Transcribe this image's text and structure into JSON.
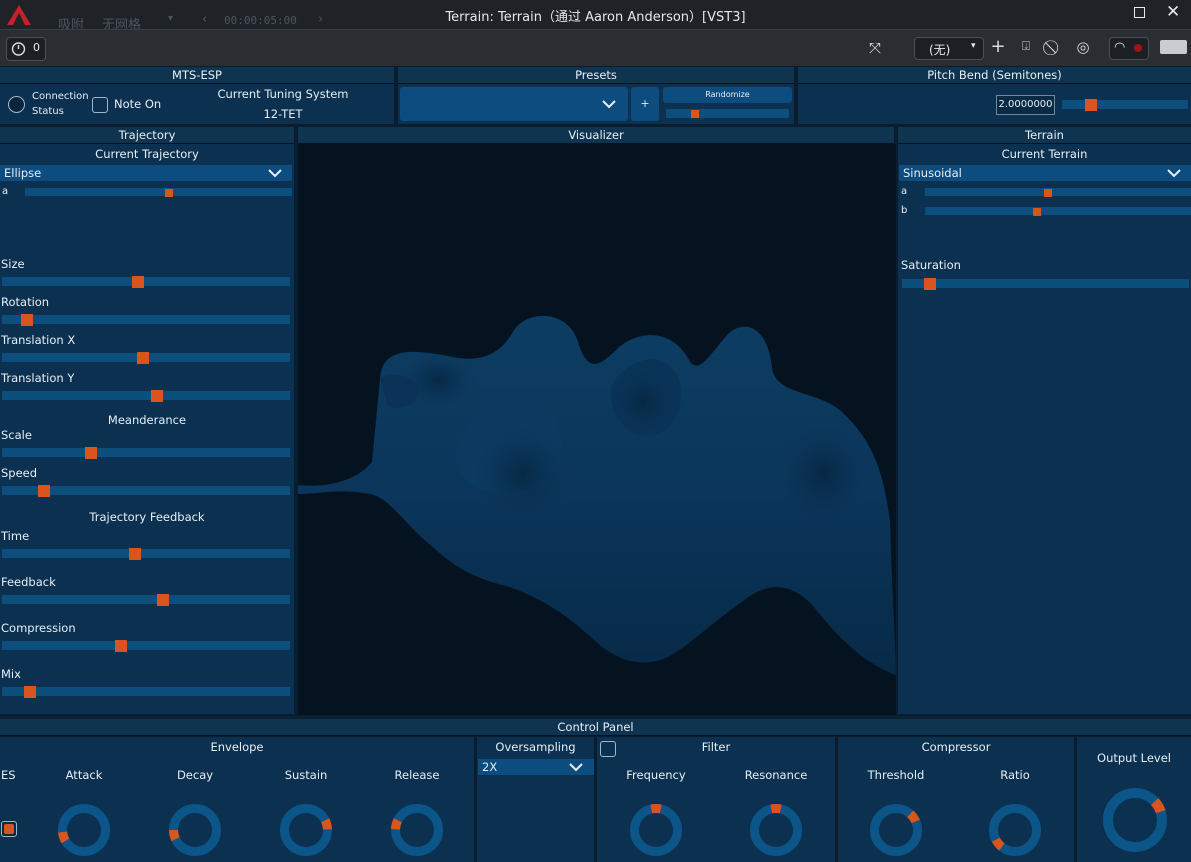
{
  "host": {
    "title": "Terrain: Terrain（通过 Aaron Anderson）[VST3]",
    "snap_label": "吸附",
    "grid_label": "无网格",
    "time": "00:00:05:00",
    "timer_value": "0",
    "preset_select": "(无)"
  },
  "mts": {
    "header": "MTS-ESP",
    "connection_label_line1": "Connection",
    "connection_label_line2": "Status",
    "note_on_label": "Note On",
    "tuning_label": "Current Tuning System",
    "tuning_value": "12-TET"
  },
  "presets": {
    "header": "Presets",
    "plus_label": "+",
    "randomize_label": "Randomize",
    "randomize_level": 0.22
  },
  "pitch_bend": {
    "header": "Pitch Bend (Semitones)",
    "value": "2.0000000",
    "level": 0.2
  },
  "trajectory": {
    "header": "Trajectory",
    "current_label": "Current Trajectory",
    "current_value": "Ellipse",
    "param_a_label": "a",
    "param_a_level": 0.54,
    "sliders": [
      {
        "label": "Size",
        "level": 0.47
      },
      {
        "label": "Rotation",
        "level": 0.07
      },
      {
        "label": "Translation X",
        "level": 0.49
      },
      {
        "label": "Translation Y",
        "level": 0.54
      }
    ],
    "meanderance_label": "Meanderance",
    "meanderance": [
      {
        "label": "Scale",
        "level": 0.3
      },
      {
        "label": "Speed",
        "level": 0.13
      }
    ],
    "feedback_label": "Trajectory Feedback",
    "feedback": [
      {
        "label": "Time",
        "level": 0.46
      },
      {
        "label": "Feedback",
        "level": 0.56
      },
      {
        "label": "Compression",
        "level": 0.41
      },
      {
        "label": "Mix",
        "level": 0.08
      }
    ]
  },
  "visualizer": {
    "header": "Visualizer"
  },
  "terrain": {
    "header": "Terrain",
    "current_label": "Current Terrain",
    "current_value": "Sinusoidal",
    "a_label": "a",
    "a_level": 0.46,
    "b_label": "b",
    "b_level": 0.42,
    "saturation_label": "Saturation",
    "saturation_level": 0.08
  },
  "control_panel": {
    "header": "Control Panel",
    "envelope": {
      "header": "Envelope",
      "es_label": "ES",
      "knobs": [
        {
          "label": "Attack",
          "value": 0.1
        },
        {
          "label": "Decay",
          "value": 0.12
        },
        {
          "label": "Sustain",
          "value": 0.78
        },
        {
          "label": "Release",
          "value": 0.22
        }
      ]
    },
    "oversampling": {
      "header": "Oversampling",
      "value": "2X"
    },
    "filter": {
      "header": "Filter",
      "knobs": [
        {
          "label": "Frequency",
          "value": 0.5
        },
        {
          "label": "Resonance",
          "value": 0.5
        }
      ]
    },
    "compressor": {
      "header": "Compressor",
      "knobs": [
        {
          "label": "Threshold",
          "value": 0.7
        },
        {
          "label": "Ratio",
          "value": 0.02
        }
      ]
    },
    "output": {
      "label": "Output Level",
      "value": 0.72
    }
  },
  "colors": {
    "panel": "#0c3150",
    "track": "#0c4e7c",
    "accent": "#d8551e",
    "background": "#0a1d2e"
  }
}
